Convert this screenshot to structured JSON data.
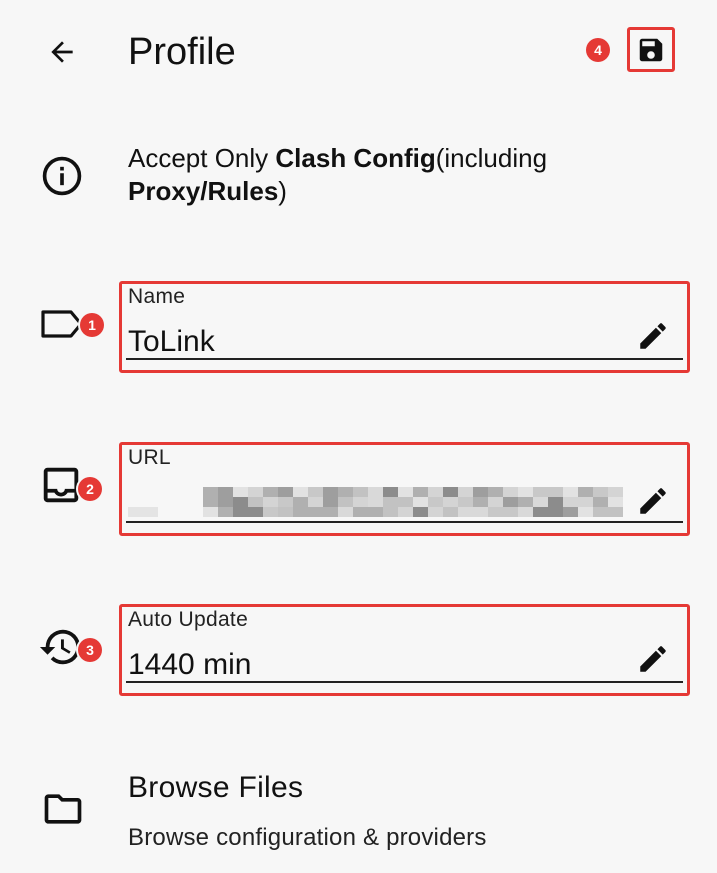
{
  "header": {
    "title": "Profile",
    "back_icon": "arrow-back-icon",
    "save_icon": "floppy-disk-save-icon",
    "save_badge": "4"
  },
  "info": {
    "icon": "info-circle-icon",
    "text_parts": [
      "Accept Only ",
      "Clash Config",
      "(including ",
      "Proxy/Rules",
      ")"
    ]
  },
  "fields": [
    {
      "id": "name",
      "label": "Name",
      "value": "ToLink",
      "badge": "1",
      "icon": "label-tag-icon",
      "edit_icon": "pencil-icon"
    },
    {
      "id": "url",
      "label": "URL",
      "value": "",
      "badge": "2",
      "icon": "inbox-tray-icon",
      "edit_icon": "pencil-icon"
    },
    {
      "id": "auto_update",
      "label": "Auto Update",
      "value": "1440 min",
      "badge": "3",
      "icon": "history-clock-icon",
      "edit_icon": "pencil-icon"
    }
  ],
  "browse": {
    "icon": "folder-icon",
    "title": "Browse Files",
    "subtitle": "Browse configuration & providers"
  },
  "colors": {
    "background": "#f7f7f7",
    "highlight": "#e53935",
    "text": "#111111"
  }
}
